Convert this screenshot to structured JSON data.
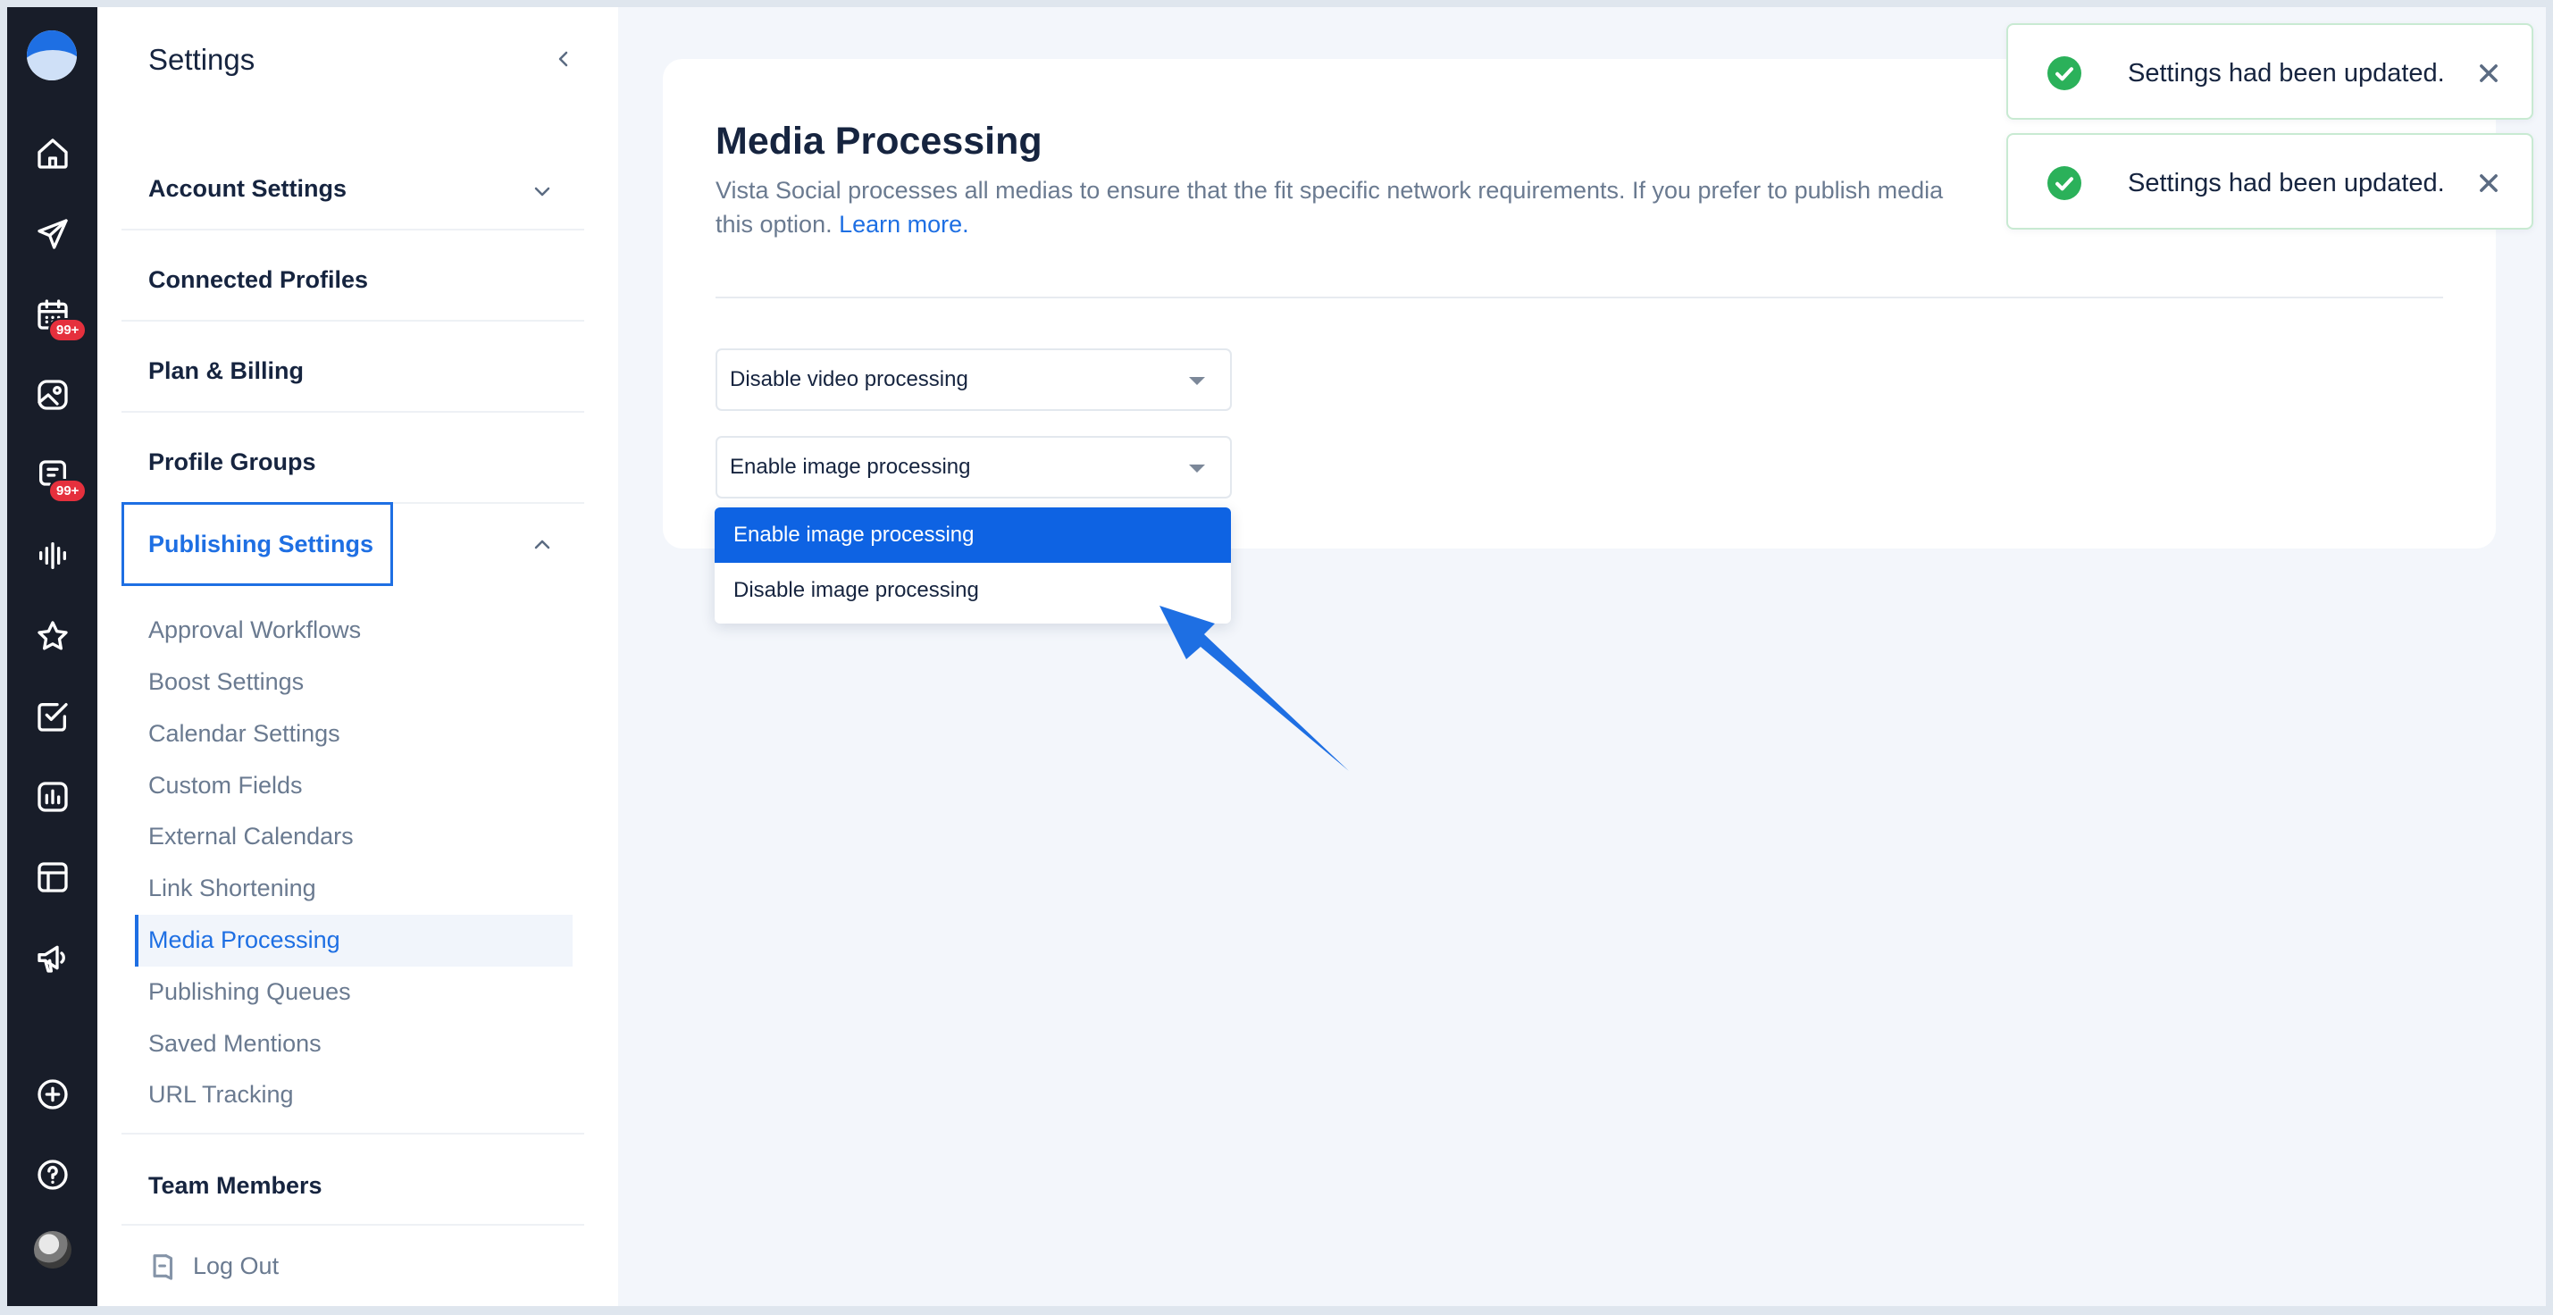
{
  "rail": {
    "badges": [
      "99+",
      "99+"
    ],
    "icons": [
      "home-icon",
      "send-icon",
      "calendar-icon",
      "media-library-icon",
      "inbox-icon",
      "listening-icon",
      "reviews-icon",
      "tasks-icon",
      "reports-icon",
      "templates-icon",
      "ads-icon",
      "add-icon",
      "help-icon"
    ]
  },
  "sidebar": {
    "title": "Settings",
    "sections": {
      "account": "Account Settings",
      "profiles": "Connected Profiles",
      "billing": "Plan & Billing",
      "groups": "Profile Groups",
      "publishing": "Publishing Settings",
      "team": "Team Members"
    },
    "publishing_items": [
      "Approval Workflows",
      "Boost Settings",
      "Calendar Settings",
      "Custom Fields",
      "External Calendars",
      "Link Shortening",
      "Media Processing",
      "Publishing Queues",
      "Saved Mentions",
      "URL Tracking"
    ],
    "logout": "Log Out"
  },
  "main": {
    "title": "Media Processing",
    "description": "Vista Social processes all medias to ensure that the fit specific network requirements. If you prefer to publish media",
    "description_cont": "this option.",
    "learn_more": "Learn more.",
    "video_select": "Disable video processing",
    "image_select": "Enable image processing",
    "image_options": [
      "Enable image processing",
      "Disable image processing"
    ]
  },
  "toasts": [
    "Settings had been updated.",
    "Settings had been updated."
  ],
  "colors": {
    "accent": "#1e6fe3",
    "rail": "#181d29",
    "success": "#2bb15a",
    "badge": "#e5303d"
  }
}
